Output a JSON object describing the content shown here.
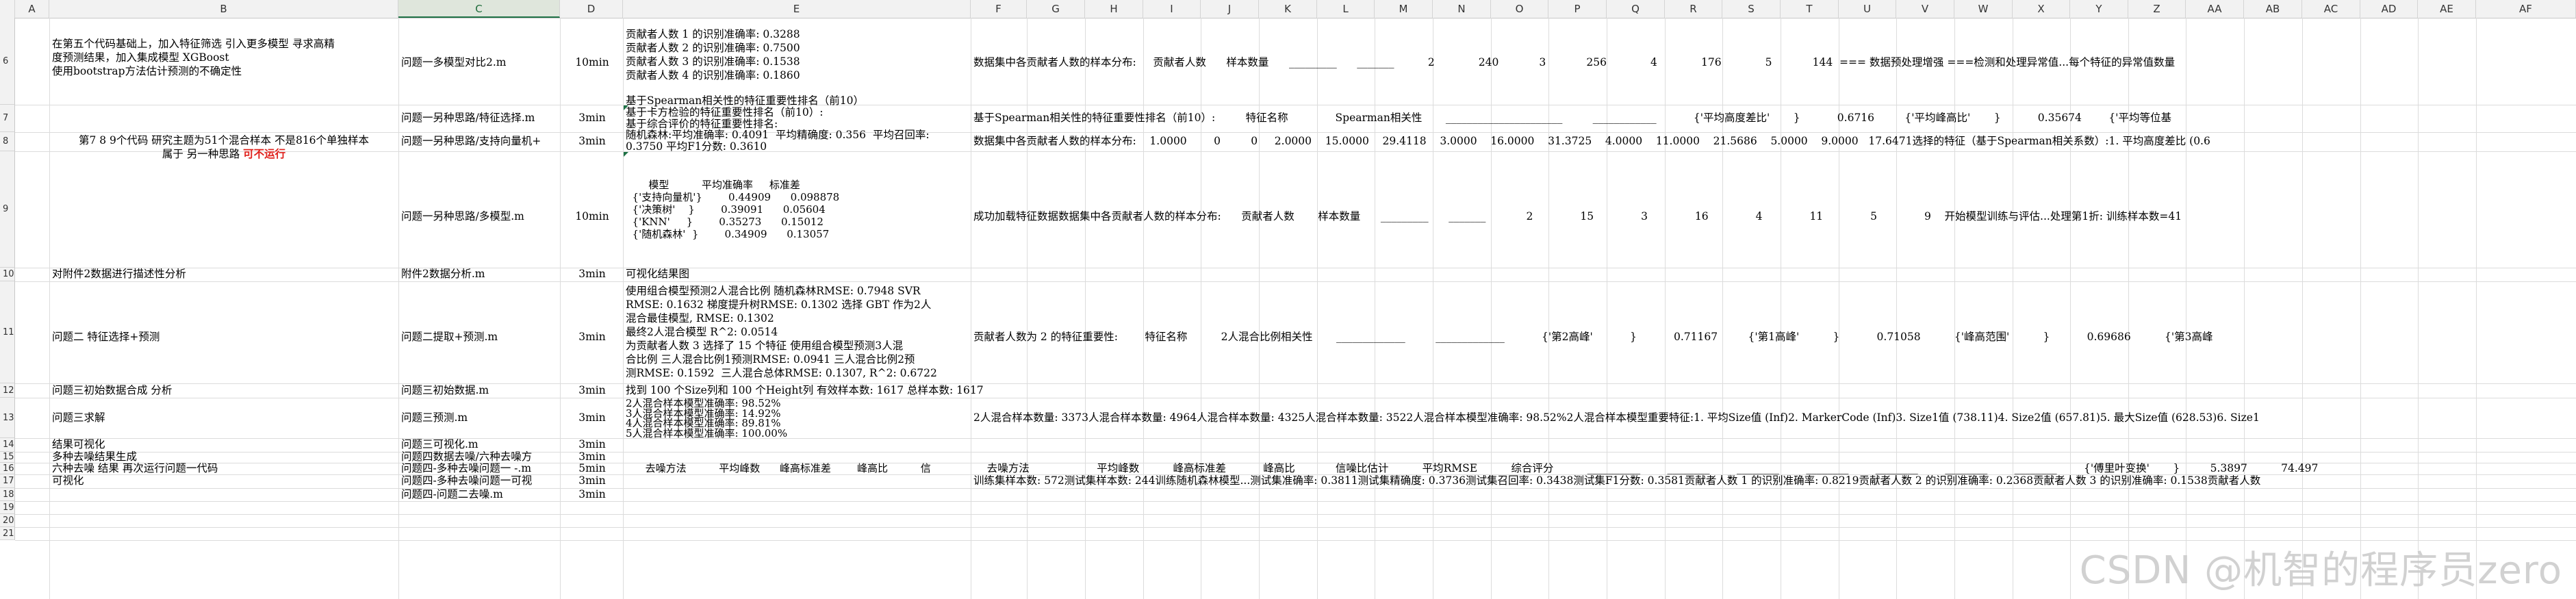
{
  "columns": [
    "A",
    "B",
    "C",
    "D",
    "E",
    "F",
    "G",
    "H",
    "I",
    "J",
    "K",
    "L",
    "M",
    "N",
    "O",
    "P",
    "Q",
    "R",
    "S",
    "T",
    "U",
    "V",
    "W",
    "X",
    "Y",
    "Z",
    "AA",
    "AB",
    "AC",
    "AD",
    "AE",
    "AF"
  ],
  "row_numbers": [
    "6",
    "7",
    "8",
    "9",
    "10",
    "11",
    "12",
    "13",
    "14",
    "15",
    "16",
    "17",
    "18",
    "19",
    "20",
    "21"
  ],
  "r6": {
    "b": "在第五个代码基础上，加入特征筛选 引入更多模型 寻求高精\n度预测结果，加入集成模型 XGBoost\n使用bootstrap方法估计预测的不确定性",
    "c": "问题一多模型对比2.m",
    "d": "10min",
    "e": "贡献者人数 1 的识别准确率: 0.3288\n贡献者人数 2 的识别准确率: 0.7500\n贡献者人数 3 的识别准确率: 0.1538\n贡献者人数 4 的识别准确率: 0.1860",
    "f": "数据集中各贡献者人数的样本分布:     贡献者人数      样本数量      _________      _______          2             240            3            256             4             176             5            144  === 数据预处理增强 ===检测和处理异常值...每个特征的异常值数量"
  },
  "r7": {
    "c": "问题一另种思路/特征选择.m",
    "d": "3min",
    "e": "基于Spearman相关性的特征重要性排名（前10）\n基于卡方检验的特征重要性排名（前10）:\n基于综合评价的特征重要性排名:",
    "f": "基于Spearman相关性的特征重要性排名（前10）:         特征名称              Spearman相关性       ______________________         ____________           {'平均高度差比'       }           0.6716         {'平均峰高比'       }           0.35674        {'平均等位基"
  },
  "r8": {
    "b1": "第7 8 9个代码 研究主题为51个混合样本 不是816个单独样本",
    "b2": "属于 另一种思路 ",
    "b_red": "可不运行",
    "c": "问题一另种思路/支持向量机+",
    "d": "3min",
    "e": "随机森林:平均准确率: 0.4091  平均精确度: 0.356  平均召回率:\n0.3750 平均F1分数: 0.3610",
    "f": "数据集中各贡献者人数的样本分布:    1.0000        0         0     2.0000    15.0000    29.4118    3.0000    16.0000    31.3725    4.0000    11.0000    21.5686    5.0000    9.0000   17.6471选择的特征（基于Spearman相关系数）:1. 平均高度差比 (0.6"
  },
  "r9": {
    "c": "问题一另种思路/多模型.m",
    "d": "10min",
    "e": "       模型          平均准确率     标准差\n  {'支持向量机'}        0.44909      0.098878\n  {'决策树'    }        0.39091      0.05604\n  {'KNN'     }        0.35273      0.15012\n  {'随机森林'  }        0.34909      0.13057",
    "f": "成功加载特征数据数据集中各贡献者人数的样本分布:      贡献者人数       样本数量      _________      _______            2              15              3              16              4              11              5              9    开始模型训练与评估...处理第1折: 训练样本数=41"
  },
  "r10": {
    "b": "对附件2数据进行描述性分析",
    "c": "附件2数据分析.m",
    "d": "3min",
    "e": "可视化结果图"
  },
  "r11": {
    "b": "问题二 特征选择+预测",
    "c": "问题二提取+预测.m",
    "d": "3min",
    "e": "使用组合模型预测2人混合比例 随机森林RMSE: 0.7948 SVR\nRMSE: 0.1632 梯度提升树RMSE: 0.1302 选择 GBT 作为2人\n混合最佳模型, RMSE: 0.1302\n最终2人混合模型 R^2: 0.0514\n为贡献者人数 3 选择了 15 个特征 使用组合模型预测3人混\n合比例 三人混合比例1预测RMSE: 0.0941 三人混合比例2预\n测RMSE: 0.1592  三人混合总体RMSE: 0.1307, R^2: 0.6722",
    "f": "贡献者人数为 2 的特征重要性:        特征名称          2人混合比例相关性       _____________         _____________           {'第2高峰'           }           0.71167         {'第1高峰'          }           0.71058          {'峰高范围'          }           0.69686          {'第3高峰"
  },
  "r12": {
    "b": "问题三初始数据合成 分析",
    "c": "问题三初始数据.m",
    "d": "3min",
    "e": "找到 100 个Size列和 100 个Height列 有效样本数: 1617 总样本数: 1617"
  },
  "r13": {
    "b": "问题三求解",
    "c": "问题三预测.m",
    "d": "3min",
    "e": "2人混合样本模型准确率: 98.52%\n3人混合样本模型准确率: 14.92%\n4人混合样本模型准确率: 89.81%\n5人混合样本模型准确率: 100.00%",
    "f": "2人混合样本数量: 3373人混合样本数量: 4964人混合样本数量: 4325人混合样本数量: 3522人混合样本模型准确率: 98.52%2人混合样本模型重要特征:1. 平均Size值 (Inf)2. MarkerCode (Inf)3. Size1值 (738.11)4. Size2值 (657.81)5. 最大Size值 (628.53)6. Size1"
  },
  "r14": {
    "b": "结果可视化",
    "c": "问题三可视化.m",
    "d": "3min"
  },
  "r15": {
    "b": "多种去噪结果生成",
    "c": "问题四数据去噪/六种去噪方",
    "d": "3min"
  },
  "r16": {
    "b": "六种去噪 结果 再次运行问题一代码",
    "c": "问题四-多种去噪问题一 -.m",
    "d": "5min",
    "e": "      去噪方法          平均峰数      峰高标准差        峰高比          信",
    "f": "    去噪方法                    平均峰数          峰高标准差           峰高比            信噪比估计          平均RMSE          综合评分          __________        ________        ________        ________        ________        ________        ________        {'傅里叶变换'       }         5.3897          74.497"
  },
  "r17": {
    "b": "可视化",
    "c": "问题四-多种去噪问题一可视",
    "d": "3min",
    "f": "训练集样本数: 572测试集样本数: 244训练随机森林模型...测试集准确率: 0.3811测试集精确度: 0.3736测试集召回率: 0.3438测试集F1分数: 0.3581贡献者人数 1 的识别准确率: 0.8219贡献者人数 2 的识别准确率: 0.2368贡献者人数 3 的识别准确率: 0.1538贡献者人数"
  },
  "r18": {
    "c": "问题四-问题二去噪.m",
    "d": "3min"
  },
  "watermark": "CSDN @机智的程序员zero"
}
